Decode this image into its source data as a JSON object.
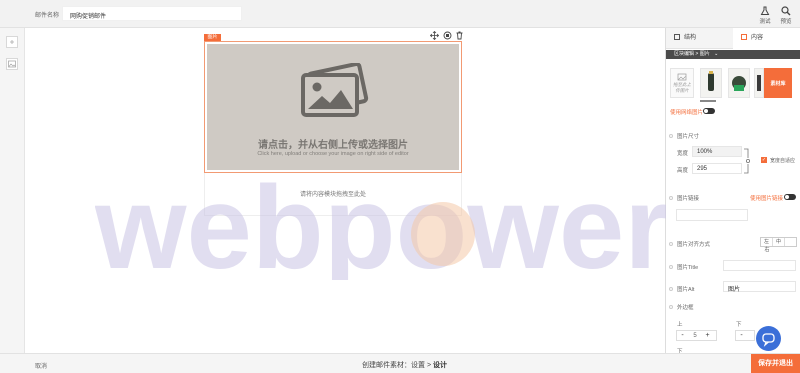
{
  "header": {
    "mail_name_label": "邮件名称",
    "mail_name_value": "网购促销邮件",
    "test_label": "测试",
    "preview_label": "预览"
  },
  "canvas": {
    "image_tag": "图片",
    "image_title": "请点击，并从右侧上传或选择图片",
    "image_subtitle": "Click here, upload or choose your image on right side of editor",
    "drop_hint": "请将内容模块拖拽至此处",
    "watermark": "webpower"
  },
  "footer": {
    "cancel_label": "取消",
    "breadcrumb_prefix": "创建邮件素材：设置 > ",
    "breadcrumb_current": "设计",
    "save_label": "保存并退出"
  },
  "panel": {
    "tabs": [
      {
        "label": "结构",
        "active": false
      },
      {
        "label": "内容",
        "active": true
      }
    ],
    "section": "区块编辑 > 图片",
    "upload_label": "拖至此上传图片",
    "library_label": "素材库",
    "use_web_image": "使用网络图片",
    "image_size": "图片尺寸",
    "width_label": "宽度",
    "width_value": "100%",
    "height_label": "高度",
    "height_value": "295",
    "auto_width": "宽度自适应",
    "image_link": "图片链接",
    "use_image_link": "使用图片链接",
    "image_align": "图片对齐方式",
    "align_options": [
      "左",
      "中",
      "右"
    ],
    "image_title": "图片Title",
    "image_alt": "图片Alt",
    "image_alt_value": "图片",
    "margin_label": "外边框",
    "margin_top_label": "上",
    "margin_top_value": "5",
    "margin_bottom_label": "下",
    "margin_next": "下"
  },
  "colors": {
    "accent": "#f46d3a",
    "section_bar": "#4b4b4b",
    "chat": "#3b6fd8"
  }
}
